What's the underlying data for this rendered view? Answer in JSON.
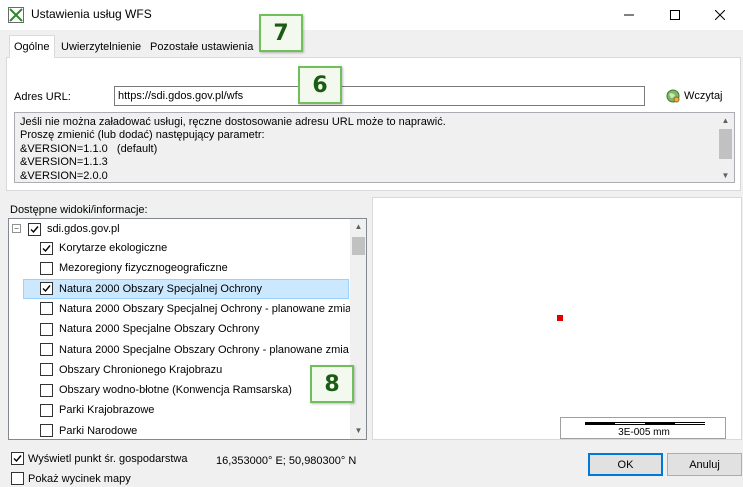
{
  "window": {
    "title": "Ustawienia usług WFS"
  },
  "tabs": [
    {
      "label": "Ogólne",
      "active": true
    },
    {
      "label": "Uwierzytelnienie",
      "active": false
    },
    {
      "label": "Pozostałe ustawienia",
      "active": false
    }
  ],
  "url": {
    "label": "Adres URL:",
    "value": "https://sdi.gdos.gov.pl/wfs",
    "load_label": "Wczytaj"
  },
  "info": {
    "text": "Jeśli nie można załadować usługi, ręczne dostosowanie adresu URL może to naprawić.\nProszę zmienić (lub dodać) następujący parametr:\n&VERSION=1.1.0   (default)\n&VERSION=1.1.3\n&VERSION=2.0.0"
  },
  "layers": {
    "label": "Dostępne widoki/informacje:",
    "root": {
      "label": "sdi.gdos.gov.pl",
      "checked": true,
      "expander": "−"
    },
    "items": [
      {
        "label": "Korytarze ekologiczne",
        "checked": true,
        "selected": false
      },
      {
        "label": "Mezoregiony fizycznogeograficzne",
        "checked": false,
        "selected": false
      },
      {
        "label": "Natura 2000 Obszary Specjalnej Ochrony",
        "checked": true,
        "selected": true
      },
      {
        "label": "Natura 2000 Obszary Specjalnej Ochrony - planowane zmia",
        "checked": false,
        "selected": false
      },
      {
        "label": "Natura 2000 Specjalne Obszary Ochrony",
        "checked": false,
        "selected": false
      },
      {
        "label": "Natura 2000 Specjalne Obszary Ochrony - planowane zmia",
        "checked": false,
        "selected": false
      },
      {
        "label": "Obszary Chronionego Krajobrazu",
        "checked": false,
        "selected": false
      },
      {
        "label": "Obszary wodno-błotne (Konwencja Ramsarska)",
        "checked": false,
        "selected": false
      },
      {
        "label": "Parki Krajobrazowe",
        "checked": false,
        "selected": false
      },
      {
        "label": "Parki Narodowe",
        "checked": false,
        "selected": false
      }
    ]
  },
  "map": {
    "scale_label": "3E-005 mm",
    "point_color": "#e00000"
  },
  "bottom": {
    "show_point_label": "Wyświetl punkt śr. gospodarstwa",
    "show_point_checked": true,
    "coords": "16,353000° E; 50,980300° N",
    "show_extent_label": "Pokaż wycinek mapy",
    "show_extent_checked": false,
    "ok_label": "OK",
    "cancel_label": "Anuluj"
  },
  "callouts": {
    "c7": "7",
    "c6": "6",
    "c8": "8"
  }
}
